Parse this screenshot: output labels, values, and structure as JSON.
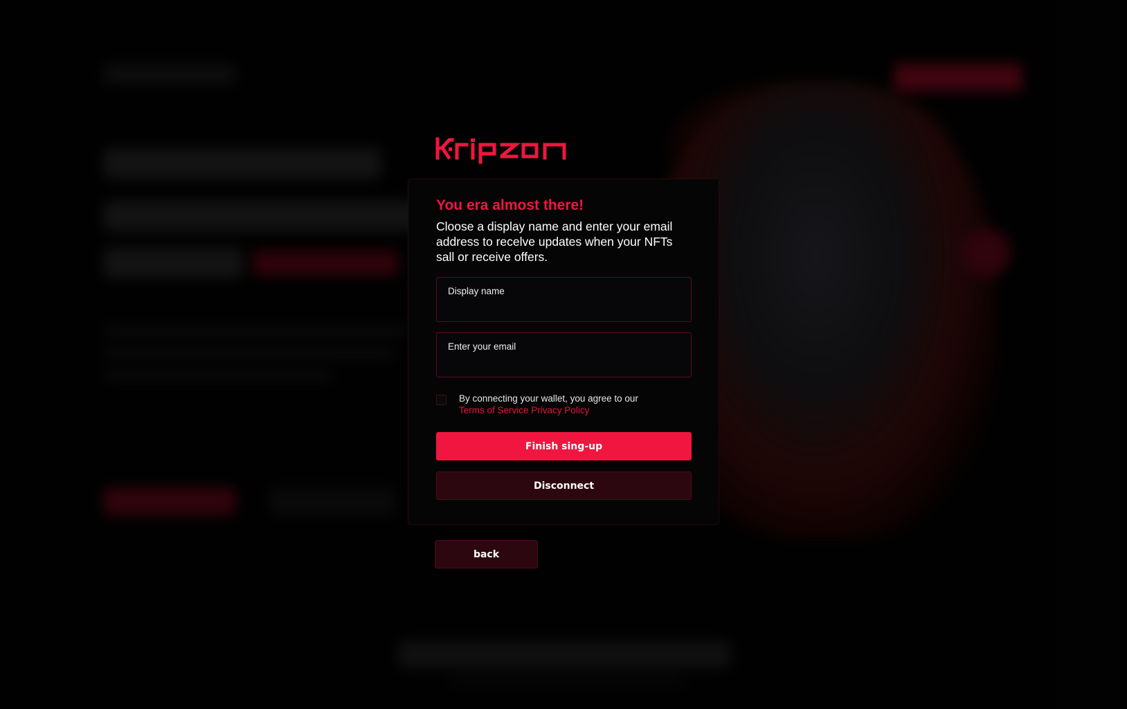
{
  "brand": {
    "name": "Kripzon",
    "accent_color": "#f0163f"
  },
  "modal": {
    "title": "You era almost there!",
    "description": "Cloose a display name and enter your email address to recelve updates when your NFTs sall or receive offers.",
    "display_name_field": {
      "label": "Display name",
      "value": ""
    },
    "email_field": {
      "label": "Enter your email",
      "value": ""
    },
    "agreement": {
      "text": "By connecting your wallet, you agree to our",
      "terms_link": "Terms of Service",
      "privacy_link": "Privacy Policy",
      "checked": false
    },
    "finish_button": "Finish sing-up",
    "disconnect_button": "Disconnect"
  },
  "back_button": "back",
  "colors": {
    "background": "#030303",
    "modal_background": "#050505",
    "primary_button": "#f0163f",
    "secondary_button": "#2c0710",
    "field_border": "#5c0c1c"
  }
}
